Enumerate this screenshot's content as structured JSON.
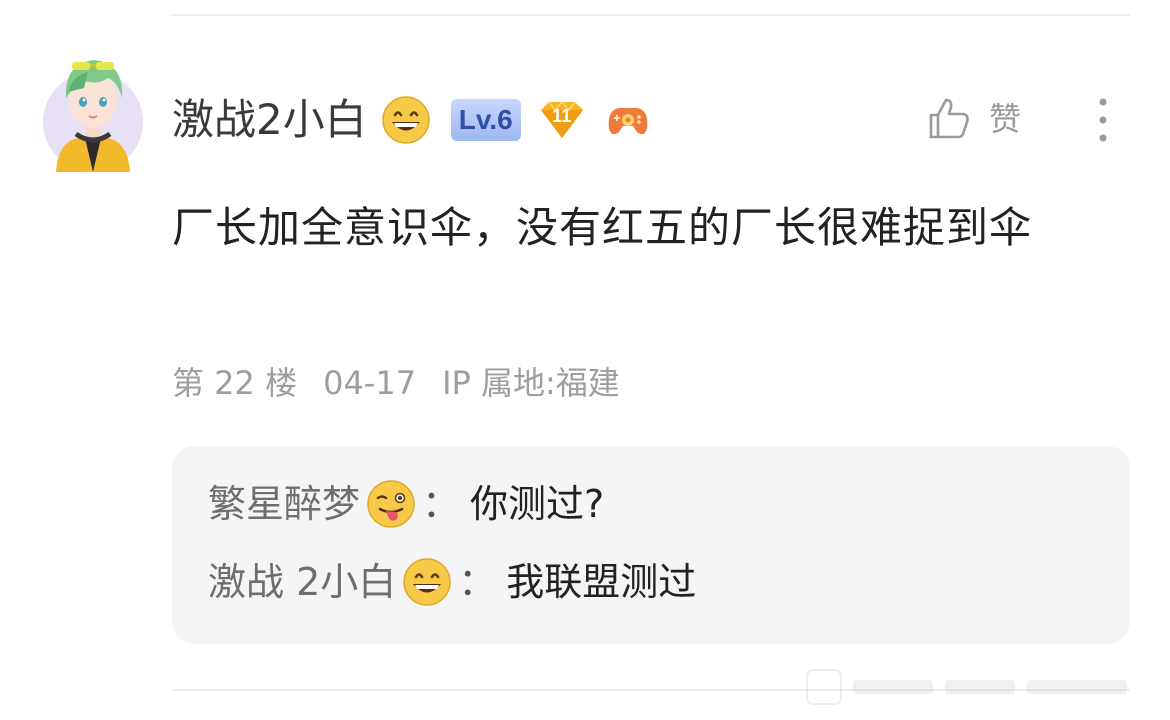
{
  "post": {
    "username": "激战2小白",
    "user_emoji": "grinning-face",
    "level_badge": "Lv.6",
    "gem_badge_number": "11",
    "like_label": "赞",
    "content": "厂长加全意识伞，没有红五的厂长很难捉到伞",
    "meta": {
      "floor": "第 22 楼",
      "date": "04-17",
      "ip": "IP 属地:福建"
    }
  },
  "replies": [
    {
      "name": "繁星醉梦",
      "emoji": "winking-face-with-tongue",
      "separator": "：",
      "text": "你测过?"
    },
    {
      "name": "激战 2小白",
      "emoji": "grinning-face",
      "separator": "：",
      "text": "我联盟测过"
    }
  ],
  "colors": {
    "username": "#3a3a3a",
    "content": "#222222",
    "meta": "#9e9e9e",
    "reply_background": "#f5f5f7",
    "reply_name": "#6e6e6e",
    "level_badge_bg": "#b3c7f7",
    "level_badge_text": "#2f4fa8",
    "gem_badge": "#f5b526",
    "gamepad_badge": "#f07a3c"
  }
}
